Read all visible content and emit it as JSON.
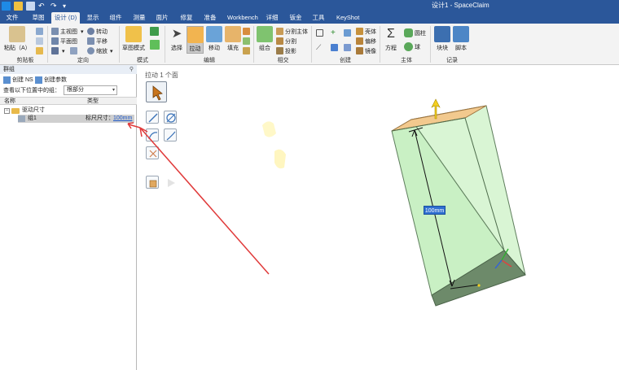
{
  "window": {
    "title": "设计1 - SpaceClaim"
  },
  "menu": {
    "tabs": [
      {
        "label": "文件",
        "active": false
      },
      {
        "label": "草图",
        "active": false
      },
      {
        "label": "设计 (D)",
        "active": true
      },
      {
        "label": "显示",
        "active": false
      },
      {
        "label": "组件",
        "active": false
      },
      {
        "label": "测量",
        "active": false
      },
      {
        "label": "面片",
        "active": false
      },
      {
        "label": "修复",
        "active": false
      },
      {
        "label": "准备",
        "active": false
      },
      {
        "label": "Workbench",
        "active": false
      },
      {
        "label": "详细",
        "active": false
      },
      {
        "label": "钣金",
        "active": false
      },
      {
        "label": "工具",
        "active": false
      },
      {
        "label": "KeyShot",
        "active": false
      }
    ]
  },
  "ribbon": {
    "clipboard": {
      "label": "剪贴板",
      "paste": "粘贴（A）"
    },
    "orient": {
      "label": "定向",
      "home_view": "主视图",
      "rotate": "转动",
      "plan_view": "平面图",
      "pan": "平移",
      "zoom": "缩放"
    },
    "mode": {
      "label": "模式",
      "sketch_mode": "草图模式"
    },
    "edit": {
      "label": "编辑",
      "select": "选择",
      "pull": "拉动",
      "move": "移动",
      "fill": "填充"
    },
    "intersect": {
      "label": "相交",
      "combine": "组合",
      "split_body": "分割主体",
      "split": "分割",
      "project": "投影"
    },
    "create": {
      "label": "创建",
      "shell": "壳体",
      "offset": "偏移",
      "mirror": "镜像"
    },
    "body": {
      "label": "主体",
      "equation": "方程",
      "cylinder": "圆柱",
      "sphere": "球"
    },
    "record": {
      "label": "记录",
      "block": "块块",
      "script": "脚本"
    }
  },
  "panel": {
    "title": "群组",
    "pin": "⚲",
    "create_ns": "创建 NS",
    "create_param": "创建参数",
    "filter_label": "查看以下位置中的组：",
    "filter_value": "根部分",
    "columns": {
      "name": "名称",
      "type": "类型"
    },
    "tree": {
      "root_label": "驱动尺寸",
      "item_label": "组1",
      "item_type": "标尺尺寸：",
      "item_value": "100mm"
    }
  },
  "canvas": {
    "hint": "拉动 1 个面",
    "dimension_label": "100mm"
  },
  "colors": {
    "title_bar": "#2b579a",
    "ribbon_bg": "#f3f3f3",
    "box_side": "#c9f0c4",
    "box_top": "#f2c98e",
    "arrow": "#e03a3a",
    "dim_label": "#2f6fd0"
  }
}
